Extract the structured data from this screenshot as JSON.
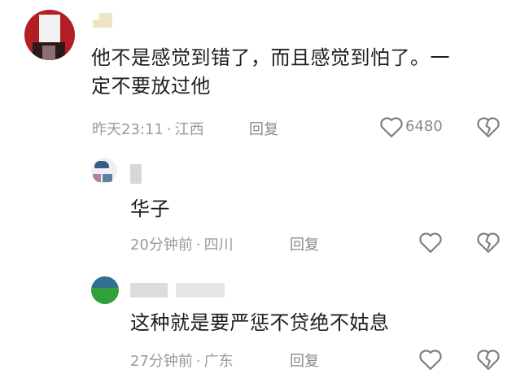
{
  "comments": [
    {
      "text_line1": "他不是感觉到错了，而且感觉到怕了。一",
      "text_line2": "定不要放过他",
      "time": "昨天23:11",
      "location": "江西",
      "reply_label": "回复",
      "like_count": "6480"
    },
    {
      "text": "华子",
      "time": "20分钟前",
      "location": "四川",
      "reply_label": "回复"
    },
    {
      "text": "这种就是要严惩不贷绝不姑息",
      "time": "27分钟前",
      "location": "广东",
      "reply_label": "回复"
    }
  ],
  "separator": "·",
  "icons": [
    "heart-outline-icon",
    "broken-heart-icon"
  ]
}
